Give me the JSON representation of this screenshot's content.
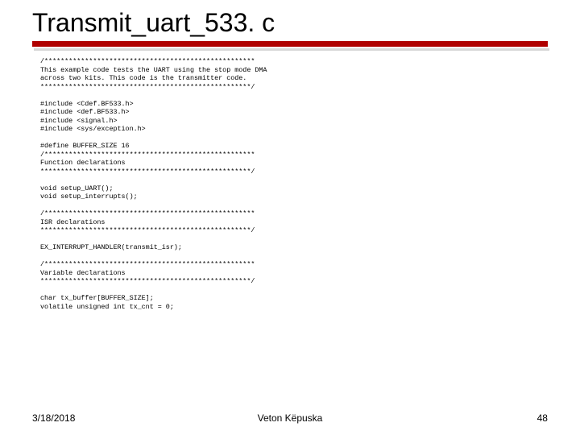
{
  "title": "Transmit_uart_533. c",
  "code": "/****************************************************\nThis example code tests the UART using the stop mode DMA\nacross two kits. This code is the transmitter code.\n****************************************************/\n\n#include <Cdef.BF533.h>\n#include <def.BF533.h>\n#include <signal.h>\n#include <sys/exception.h>\n\n#define BUFFER_SIZE 16\n/****************************************************\nFunction declarations\n****************************************************/\n\nvoid setup_UART();\nvoid setup_interrupts();\n\n/****************************************************\nISR declarations\n****************************************************/\n\nEX_INTERRUPT_HANDLER(transmit_isr);\n\n/****************************************************\nVariable declarations\n****************************************************/\n\nchar tx_buffer[BUFFER_SIZE];\nvolatile unsigned int tx_cnt = 0;",
  "footer": {
    "date": "3/18/2018",
    "author": "Veton Këpuska",
    "page": "48"
  }
}
